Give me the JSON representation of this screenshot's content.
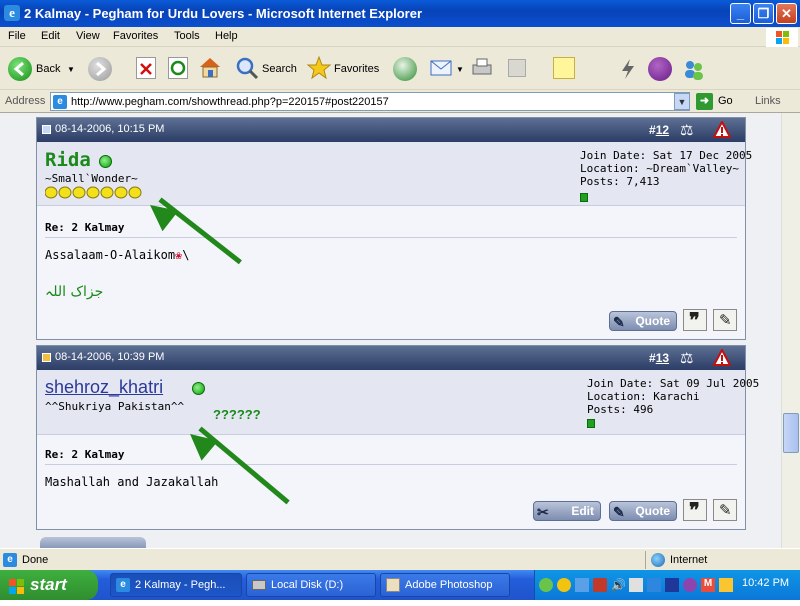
{
  "window": {
    "title": "2 Kalmay - Pegham for Urdu Lovers - Microsoft Internet Explorer"
  },
  "menu": [
    "File",
    "Edit",
    "View",
    "Favorites",
    "Tools",
    "Help"
  ],
  "toolbar": {
    "back": "Back",
    "search": "Search",
    "favorites": "Favorites"
  },
  "address": {
    "label": "Address",
    "url": "http://www.pegham.com/showthread.php?p=220157#post220157",
    "go": "Go",
    "links": "Links"
  },
  "posts": [
    {
      "date": "08-14-2006, 10:15 PM",
      "number": "12",
      "hash": "#",
      "username": "Rida",
      "usertitle": "~Small`Wonder~",
      "join": "Join Date: Sat 17 Dec 2005",
      "location": "Location: ~Dream`Valley~",
      "posts": "Posts: 7,413",
      "title": "Re: 2 Kalmay",
      "body": "Assalaam-O-Alaikom",
      "body_suffix": "\\",
      "urdu": "جزاک اللہ",
      "quote": "Quote"
    },
    {
      "date": "08-14-2006, 10:39 PM",
      "number": "13",
      "hash": "#",
      "username": "shehroz_khatri",
      "usertitle": "^^Shukriya Pakistan^^",
      "annotation": "??????",
      "join": "Join Date: Sat 09 Jul 2005",
      "location": "Location: Karachi",
      "posts": "Posts: 496",
      "title": "Re: 2 Kalmay",
      "body": "Mashallah and Jazakallah",
      "edit": "Edit",
      "quote": "Quote"
    }
  ],
  "status": {
    "text": "Done",
    "zone": "Internet"
  },
  "taskbar": {
    "start": "start",
    "tasks": [
      "2 Kalmay - Pegh...",
      "Local Disk (D:)",
      "Adobe Photoshop"
    ],
    "clock": "10:42 PM"
  },
  "colors": {
    "title_blue": "#0a5bd8",
    "post_header": "#3a4b73",
    "username_green": "#1a8a1a",
    "arrow_green": "#22881c"
  }
}
